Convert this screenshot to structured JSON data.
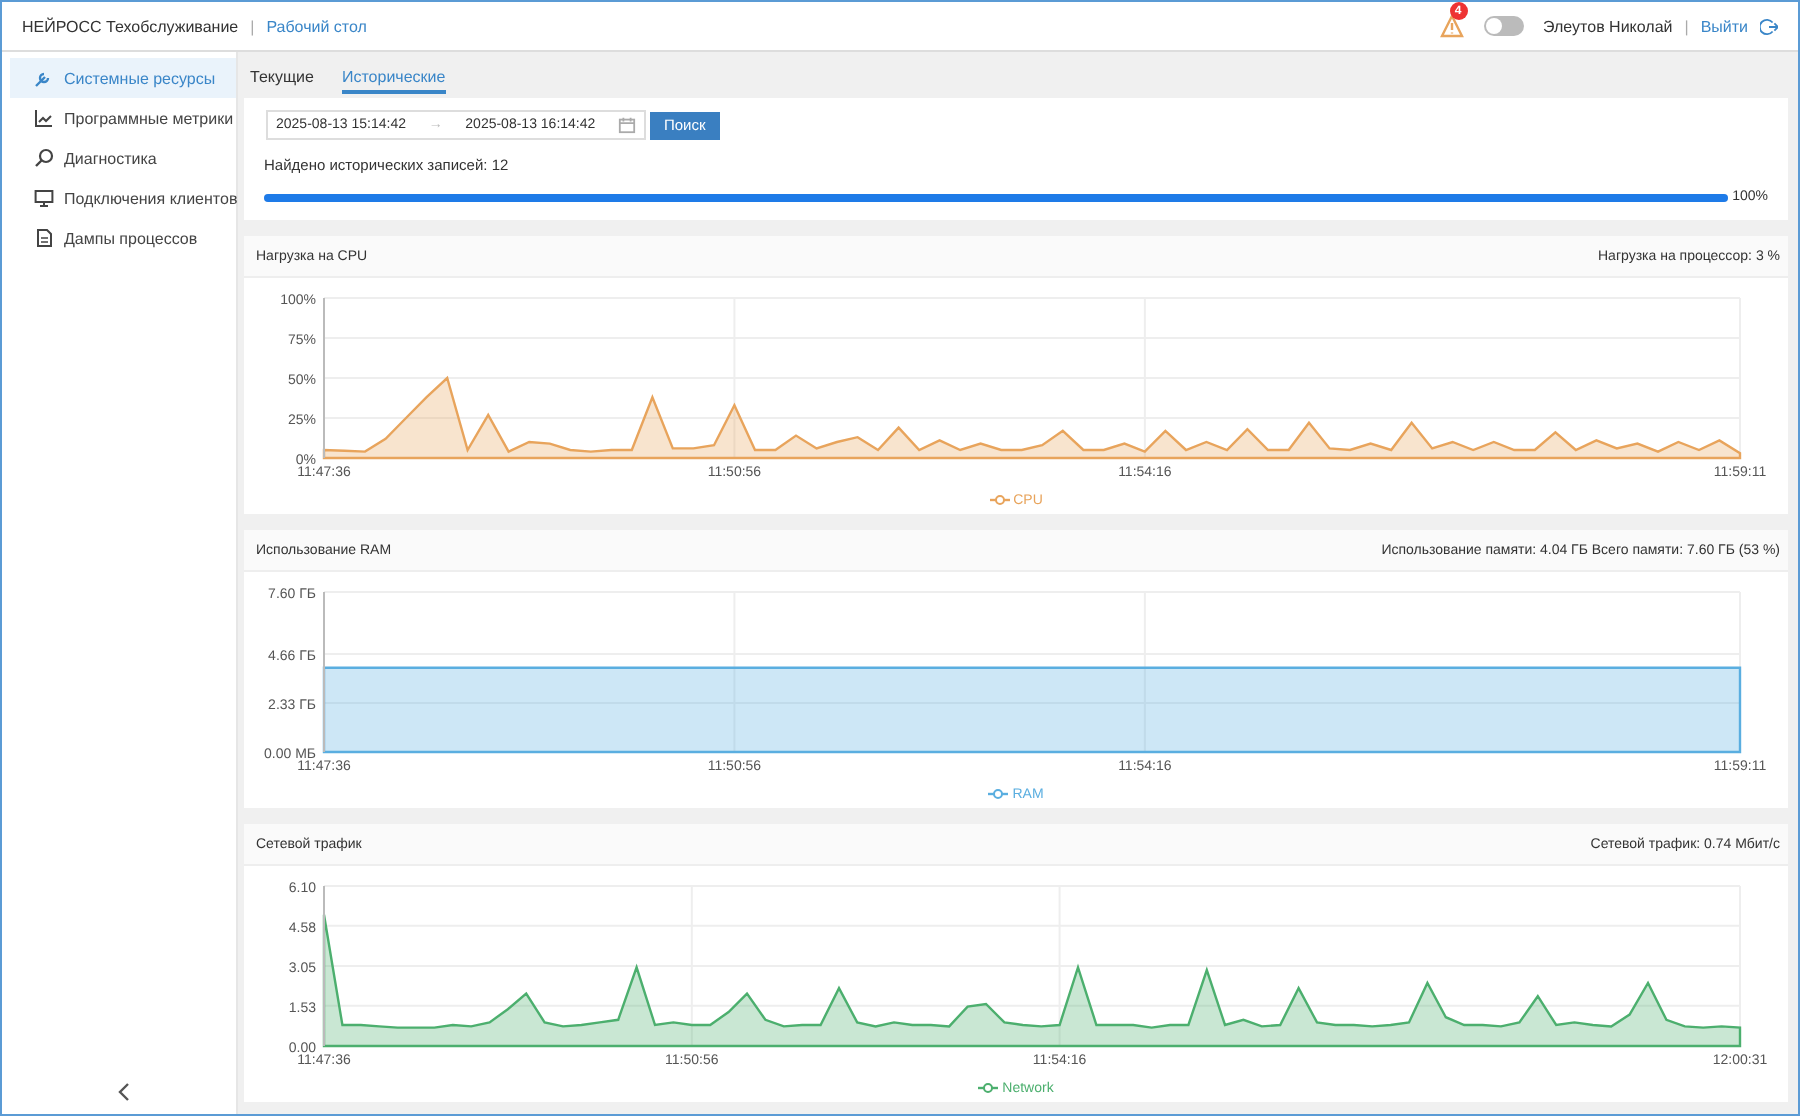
{
  "header": {
    "app_title": "НЕЙРОСС Техобслуживание",
    "separator": "|",
    "link": "Рабочий стол",
    "alert_count": "4",
    "theme_toggle_on": false,
    "user": "Элеутов Николай",
    "user_separator": "|",
    "logout": "Выйти"
  },
  "sidebar": {
    "items": [
      {
        "label": "Системные ресурсы",
        "kind": "wrench",
        "selected": true
      },
      {
        "label": "Программные метрики",
        "kind": "chart",
        "selected": false
      },
      {
        "label": "Диагностика",
        "kind": "search",
        "selected": false
      },
      {
        "label": "Подключения клиентов",
        "kind": "monitor",
        "selected": false
      },
      {
        "label": "Дампы процессов",
        "kind": "file",
        "selected": false
      }
    ]
  },
  "tabs": [
    {
      "label": "Текущие",
      "selected": false
    },
    {
      "label": "Исторические",
      "selected": true
    }
  ],
  "filter": {
    "start": "2025-08-13 15:14:42",
    "arrow": "→",
    "end": "2025-08-13 16:14:42",
    "search_button": "Поиск",
    "found": "Найдено исторических записей: 12",
    "progress": {
      "level": 1,
      "reading": "100%"
    }
  },
  "panels": [
    {
      "title": "Нагрузка на CPU",
      "summary": "Нагрузка на процессор: 3 %",
      "chart_data": {
        "type": "area",
        "ylim": [
          0,
          100
        ],
        "yticks": [
          {
            "value": 0,
            "label": "0%"
          },
          {
            "value": 25,
            "label": "25%"
          },
          {
            "value": 50,
            "label": "50%"
          },
          {
            "value": 75,
            "label": "75%"
          },
          {
            "value": 100,
            "label": "100%"
          }
        ],
        "grid": true,
        "categories": [
          "11:47:36",
          null,
          null,
          null,
          null,
          null,
          null,
          null,
          null,
          null,
          null,
          null,
          null,
          null,
          null,
          null,
          null,
          null,
          null,
          null,
          "11:50:56",
          null,
          null,
          null,
          null,
          null,
          null,
          null,
          null,
          null,
          null,
          null,
          null,
          null,
          null,
          null,
          null,
          null,
          null,
          null,
          "11:54:16",
          null,
          null,
          null,
          null,
          null,
          null,
          null,
          null,
          null,
          null,
          null,
          null,
          null,
          null,
          null,
          null,
          null,
          null,
          null,
          null,
          null,
          null,
          null,
          null,
          null,
          null,
          null,
          null,
          "11:59:11"
        ],
        "series": [
          {
            "name": "CPU",
            "color": "#e8a45c",
            "values": [
              5,
              4.5,
              4,
              12,
              25,
              38,
              50,
              5,
              27,
              4,
              10,
              9,
              5,
              4,
              5,
              5,
              38,
              6,
              6,
              8,
              33,
              5,
              5,
              14,
              6,
              10,
              13,
              5,
              19,
              5,
              11,
              5,
              9,
              5,
              5,
              8,
              17,
              5,
              5,
              9,
              4,
              17,
              5,
              10,
              5,
              18,
              5,
              5,
              22,
              6,
              5,
              9,
              5,
              22,
              6,
              10,
              5,
              10,
              5,
              5,
              16,
              5,
              11,
              6,
              9,
              4,
              10,
              5,
              11,
              3
            ]
          }
        ]
      }
    },
    {
      "title": "Использование RAM",
      "summary": "Использование памяти: 4.04 ГБ  Всего памяти: 7.60 ГБ  (53 %)",
      "chart_data": {
        "type": "area",
        "ylim": [
          0,
          7.6
        ],
        "yticks": [
          {
            "value": 0,
            "label": "0.00 МБ"
          },
          {
            "value": 2.33,
            "label": "2.33 ГБ"
          },
          {
            "value": 4.66,
            "label": "4.66 ГБ"
          },
          {
            "value": 7.6,
            "label": "7.60 ГБ"
          }
        ],
        "grid": true,
        "categories": [
          "11:47:36",
          null,
          null,
          null,
          null,
          null,
          null,
          null,
          null,
          null,
          null,
          null,
          null,
          null,
          null,
          null,
          null,
          null,
          null,
          null,
          "11:50:56",
          null,
          null,
          null,
          null,
          null,
          null,
          null,
          null,
          null,
          null,
          null,
          null,
          null,
          null,
          null,
          null,
          null,
          null,
          null,
          "11:54:16",
          null,
          null,
          null,
          null,
          null,
          null,
          null,
          null,
          null,
          null,
          null,
          null,
          null,
          null,
          null,
          null,
          null,
          null,
          null,
          null,
          null,
          null,
          null,
          null,
          null,
          null,
          null,
          null,
          "11:59:11"
        ],
        "series": [
          {
            "name": "RAM",
            "color": "#5aaee0",
            "values": [
              4.0,
              4.0,
              4.0,
              4.0,
              4.0,
              4.0,
              4.0,
              4.0,
              4.0,
              4.0,
              4.0,
              4.0,
              4.0,
              4.0,
              4.0,
              4.0,
              4.0,
              4.0,
              4.0,
              4.0,
              4.0,
              4.0,
              4.0,
              4.0,
              4.0,
              4.0,
              4.0,
              4.0,
              4.0,
              4.0,
              4.0,
              4.0,
              4.0,
              4.0,
              4.0,
              4.0,
              4.0,
              4.0,
              4.0,
              4.0,
              4.0,
              4.0,
              4.0,
              4.0,
              4.0,
              4.0,
              4.0,
              4.0,
              4.0,
              4.0,
              4.0,
              4.0,
              4.0,
              4.0,
              4.0,
              4.0,
              4.0,
              4.0,
              4.0,
              4.0,
              4.0,
              4.0,
              4.0,
              4.0,
              4.0,
              4.0,
              4.0,
              4.0,
              4.0,
              4.0
            ]
          }
        ]
      }
    },
    {
      "title": "Сетевой трафик",
      "summary": "Сетевой трафик: 0.74 Мбит/с",
      "chart_data": {
        "type": "area",
        "ylim": [
          0,
          6.1
        ],
        "yticks": [
          {
            "value": 0,
            "label": "0.00"
          },
          {
            "value": 1.53,
            "label": "1.53"
          },
          {
            "value": 3.05,
            "label": "3.05"
          },
          {
            "value": 4.58,
            "label": "4.58"
          },
          {
            "value": 6.1,
            "label": "6.10"
          }
        ],
        "grid": true,
        "categories": [
          "11:47:36",
          null,
          null,
          null,
          null,
          null,
          null,
          null,
          null,
          null,
          null,
          null,
          null,
          null,
          null,
          null,
          null,
          null,
          null,
          null,
          "11:50:56",
          null,
          null,
          null,
          null,
          null,
          null,
          null,
          null,
          null,
          null,
          null,
          null,
          null,
          null,
          null,
          null,
          null,
          null,
          null,
          "11:54:16",
          null,
          null,
          null,
          null,
          null,
          null,
          null,
          null,
          null,
          null,
          null,
          null,
          null,
          null,
          null,
          null,
          null,
          null,
          null,
          null,
          null,
          null,
          null,
          null,
          null,
          null,
          null,
          null,
          null,
          null,
          null,
          null,
          null,
          null,
          null,
          null,
          "12:00:31"
        ],
        "series": [
          {
            "name": "Network",
            "color": "#4caf6e",
            "values": [
              5.0,
              0.8,
              0.8,
              0.75,
              0.7,
              0.7,
              0.7,
              0.8,
              0.75,
              0.9,
              1.4,
              2.0,
              0.9,
              0.75,
              0.8,
              0.9,
              1.0,
              3.0,
              0.8,
              0.9,
              0.8,
              0.8,
              1.3,
              2.0,
              1.0,
              0.75,
              0.8,
              0.8,
              2.2,
              0.9,
              0.75,
              0.9,
              0.8,
              0.8,
              0.75,
              1.5,
              1.6,
              0.9,
              0.8,
              0.75,
              0.8,
              3.0,
              0.8,
              0.8,
              0.8,
              0.7,
              0.8,
              0.8,
              2.9,
              0.8,
              1.0,
              0.75,
              0.8,
              2.2,
              0.9,
              0.8,
              0.8,
              0.75,
              0.8,
              0.9,
              2.4,
              1.1,
              0.8,
              0.8,
              0.75,
              0.9,
              1.9,
              0.8,
              0.9,
              0.8,
              0.75,
              1.2,
              2.4,
              1.0,
              0.75,
              0.7,
              0.75,
              0.7
            ]
          }
        ]
      }
    }
  ]
}
